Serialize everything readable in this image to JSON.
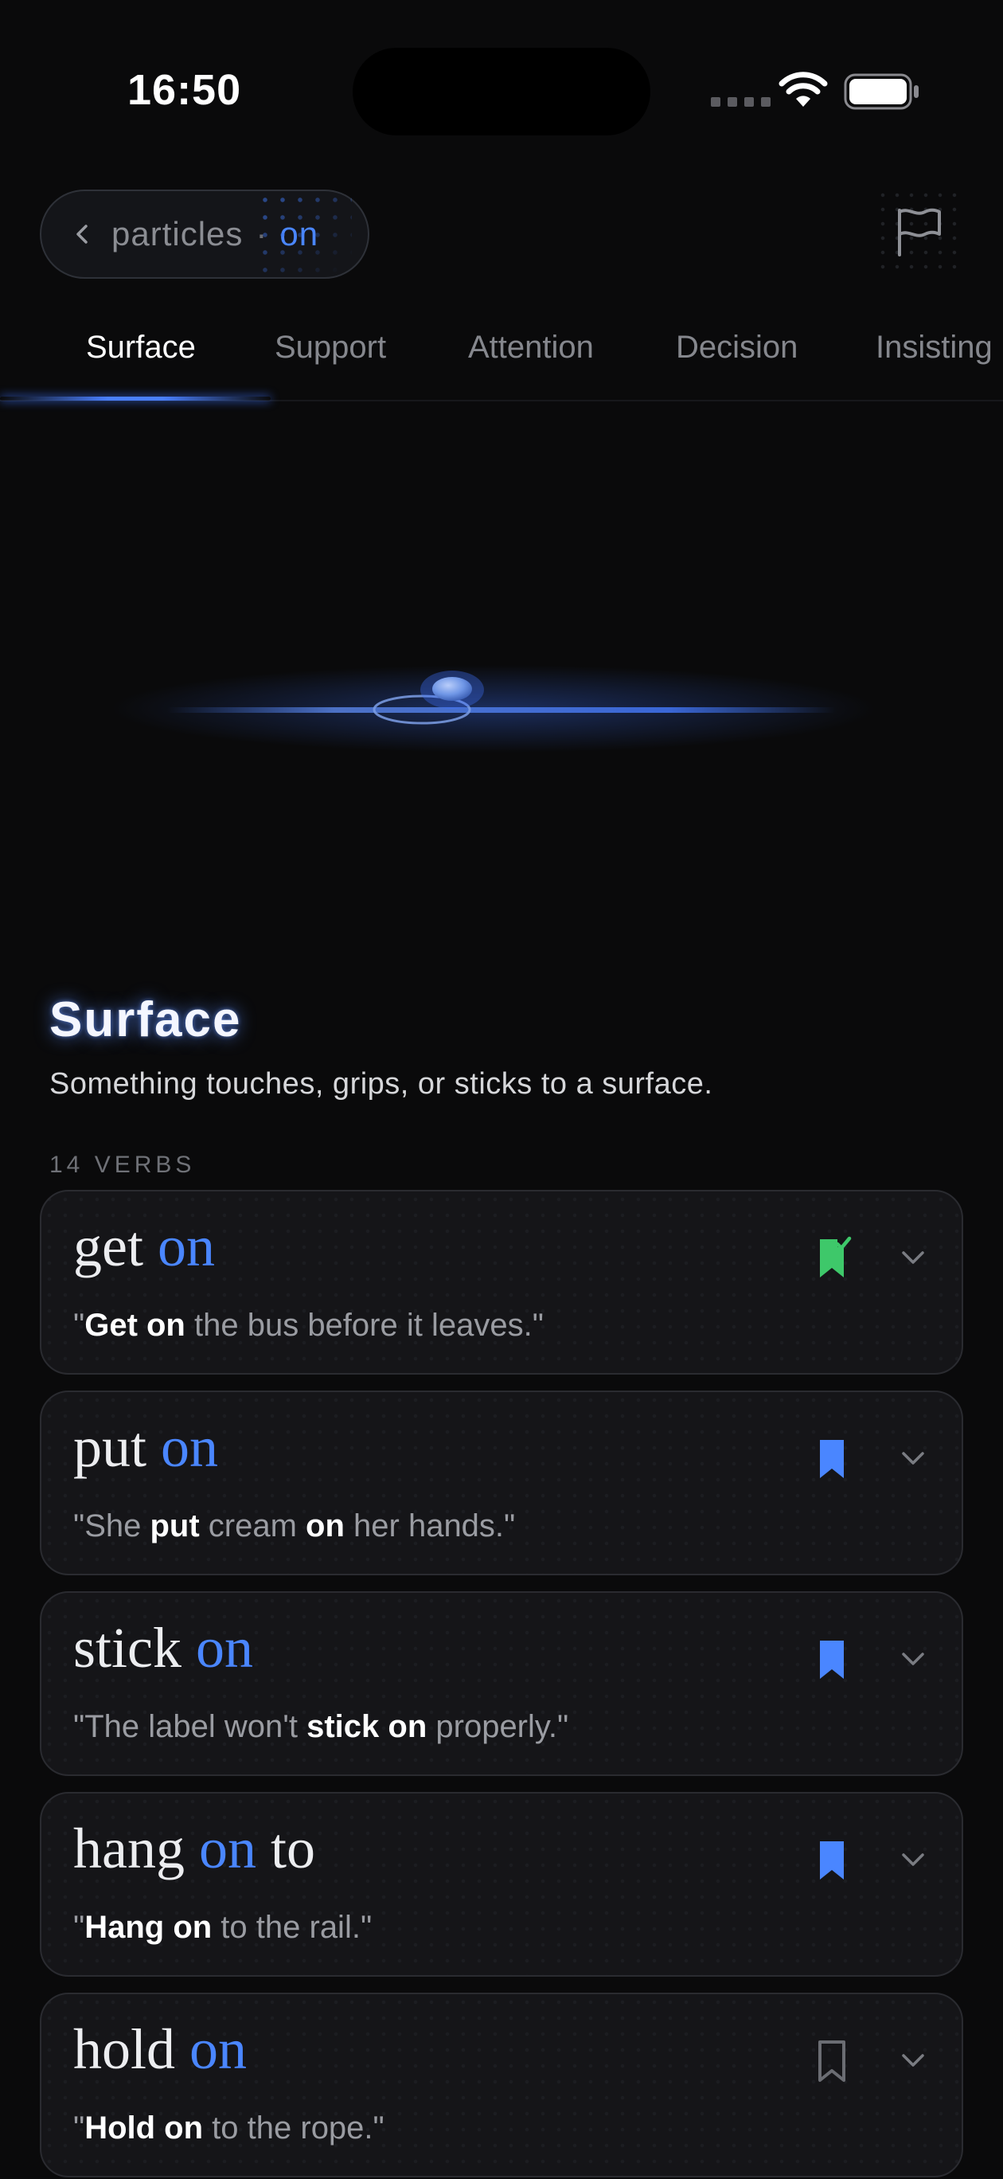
{
  "status": {
    "time": "16:50"
  },
  "breadcrumb": {
    "parent": "particles",
    "separator": "·",
    "current": "on"
  },
  "tabs": [
    {
      "label": "Surface",
      "active": true
    },
    {
      "label": "Support",
      "active": false
    },
    {
      "label": "Attention",
      "active": false
    },
    {
      "label": "Decision",
      "active": false
    },
    {
      "label": "Insisting",
      "active": false
    }
  ],
  "section": {
    "title": "Surface",
    "description": "Something touches, grips, or sticks to a surface.",
    "count_label": "14 VERBS"
  },
  "cards": [
    {
      "verb": "get",
      "particle": "on",
      "rest": "",
      "bookmark": "saved-check",
      "example": [
        [
          "q",
          "\""
        ],
        [
          "b",
          "Get on"
        ],
        [
          "t",
          " the bus before it leaves.\""
        ]
      ]
    },
    {
      "verb": "put",
      "particle": "on",
      "rest": "",
      "bookmark": "saved",
      "example": [
        [
          "t",
          "\"She "
        ],
        [
          "b",
          "put"
        ],
        [
          "t",
          " cream "
        ],
        [
          "b",
          "on"
        ],
        [
          "t",
          " her hands.\""
        ]
      ]
    },
    {
      "verb": "stick",
      "particle": "on",
      "rest": "",
      "bookmark": "saved",
      "example": [
        [
          "t",
          "\"The label won't "
        ],
        [
          "b",
          "stick on"
        ],
        [
          "t",
          " properly.\""
        ]
      ]
    },
    {
      "verb": "hang",
      "particle": "on",
      "rest": "to",
      "bookmark": "saved",
      "example": [
        [
          "q",
          "\""
        ],
        [
          "b",
          "Hang on"
        ],
        [
          "t",
          " to the rail.\""
        ]
      ]
    },
    {
      "verb": "hold",
      "particle": "on",
      "rest": "",
      "bookmark": "unsaved",
      "example": [
        [
          "q",
          "\""
        ],
        [
          "b",
          "Hold on"
        ],
        [
          "t",
          " to the rope.\""
        ]
      ]
    }
  ],
  "colors": {
    "accent": "#4a86ff",
    "saved_green": "#3ec86a",
    "background": "#0a0a0b"
  },
  "icons": {
    "back": "chevron-left-icon",
    "report": "flag-icon",
    "bookmark": "bookmark-icon",
    "expand": "chevron-down-icon"
  }
}
